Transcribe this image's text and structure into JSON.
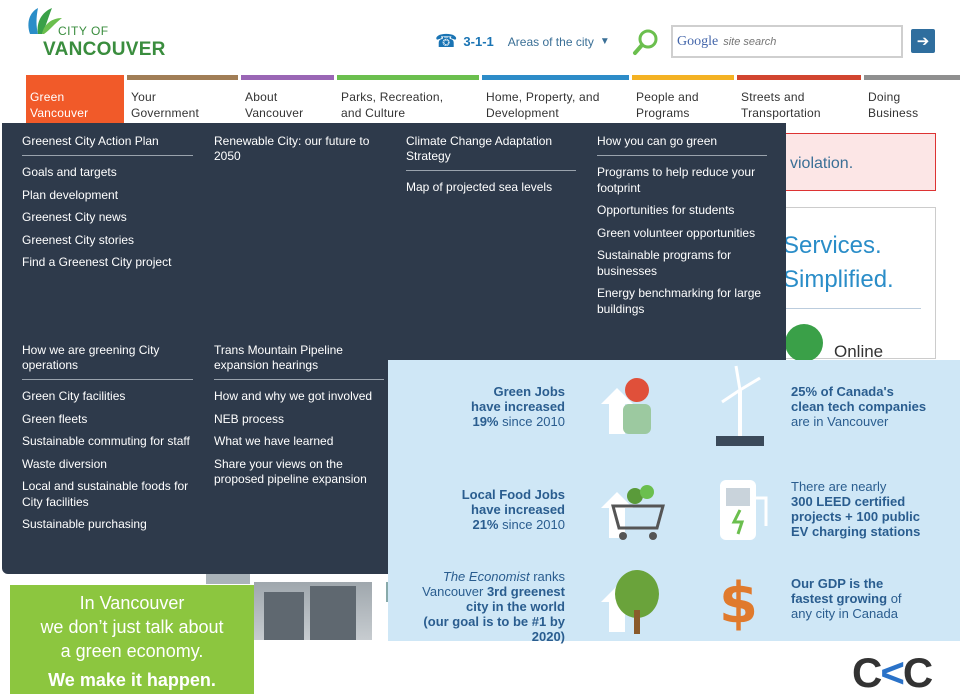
{
  "header": {
    "logo_top": "CITY OF",
    "logo_bottom": "VANCOUVER",
    "phone_number": "3-1-1",
    "areas_label": "Areas of the city",
    "search_brand": "Google",
    "search_placeholder": "site search",
    "go_label": "➔"
  },
  "nav": [
    {
      "label": "Green Vancouver",
      "line1": "Green",
      "line2": "Vancouver",
      "color": "#f15a29",
      "active": true
    },
    {
      "label": "Your Government",
      "line1": "Your",
      "line2": "Government",
      "color": "#a17e56"
    },
    {
      "label": "About Vancouver",
      "line1": "About",
      "line2": "Vancouver",
      "color": "#9a66b5"
    },
    {
      "label": "Parks, Recreation, and Culture",
      "line1": "Parks, Recreation,",
      "line2": "and Culture",
      "color": "#6bbf4e"
    },
    {
      "label": "Home, Property, and Development",
      "line1": "Home, Property, and",
      "line2": "Development",
      "color": "#2d8cc8"
    },
    {
      "label": "People and Programs",
      "line1": "People and",
      "line2": "Programs",
      "color": "#f4b223"
    },
    {
      "label": "Streets and Transportation",
      "line1": "Streets and",
      "line2": "Transportation",
      "color": "#d2452f"
    },
    {
      "label": "Doing Business",
      "line1": "Doing",
      "line2": "Business",
      "color": "#8f8f8f"
    }
  ],
  "megamenu": {
    "columns": [
      {
        "title": "Greenest City Action Plan",
        "links": [
          "Goals and targets",
          "Plan development",
          "Greenest City news",
          "Greenest City stories",
          "Find a Greenest City project"
        ]
      },
      {
        "title": "Renewable City: our future to 2050",
        "links": []
      },
      {
        "title": "Climate Change Adaptation Strategy",
        "links": [
          "Map of projected sea levels"
        ]
      },
      {
        "title": "How you can go green",
        "links": [
          "Programs to help reduce your footprint",
          "Opportunities for students",
          "Green volunteer opportunities",
          "Sustainable programs for businesses",
          "Energy benchmarking for large buildings"
        ]
      },
      {
        "title": "How we are greening City operations",
        "links": [
          "Green City facilities",
          "Green fleets",
          "Sustainable commuting for staff",
          "Waste diversion",
          "Local and sustainable foods for City facilities",
          "Sustainable purchasing"
        ]
      },
      {
        "title": "Trans Mountain Pipeline expansion hearings",
        "links": [
          "How and why we got involved",
          "NEB process",
          "What we have learned",
          "Share your views on the proposed pipeline expansion"
        ]
      }
    ]
  },
  "side": {
    "violation_text": "violation.",
    "services_line1": "Services.",
    "services_line2": "Simplified.",
    "online_label": "Online"
  },
  "infographic": {
    "green_jobs": {
      "a": "Green Jobs",
      "b": "have increased",
      "c_bold": "19%",
      "c_rest": " since 2010"
    },
    "clean_tech": {
      "a": "25% of Canada's",
      "b": "clean tech companies",
      "c": "are in Vancouver"
    },
    "food_jobs": {
      "a": "Local Food Jobs",
      "b": "have increased",
      "c_bold": "21%",
      "c_rest": " since 2010"
    },
    "leed": {
      "a": "There are nearly",
      "b": "300 LEED certified",
      "c": "projects + 100 public",
      "d": "EV charging stations"
    },
    "economist": {
      "a_italic": "The Economist",
      "a_rest": " ranks",
      "b_pre": "Vancouver ",
      "b_bold": "3rd greenest",
      "c": "city in the world",
      "d": "(our goal is to be #1 by 2020)"
    },
    "gdp": {
      "a": "Our GDP is the",
      "b_bold": "fastest growing",
      "b_rest": " of",
      "c": "any city in Canada"
    }
  },
  "banner": {
    "line1": "In Vancouver",
    "line2": "we don’t just talk about",
    "line3": "a green economy.",
    "line4": "We make it happen."
  },
  "corner_logo": {
    "c1": "C",
    "k": "<",
    "c2": "C"
  }
}
